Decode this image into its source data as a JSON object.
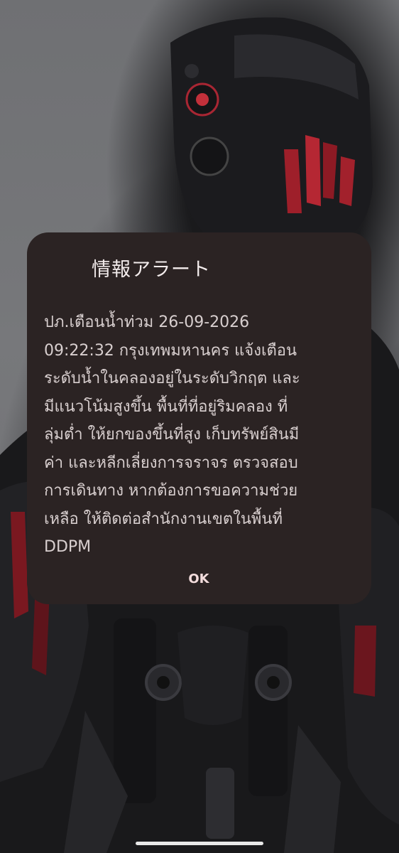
{
  "alert": {
    "title": "情報アラート",
    "message": "ปภ.เตือนน้ำท่วม  26-09-2026\n09:22:32 กรุงเทพมหานคร แจ้งเตือน\nระดับน้ำในคลองอยู่ในระดับวิกฤต และ\nมีแนวโน้มสูงขึ้น พื้นที่ที่อยู่ริมคลอง ที่\nลุ่มต่ำ ให้ยกของขึ้นที่สูง เก็บทรัพย์สินมี\nค่า และหลีกเลี่ยงการจราจร ตรวจสอบ\nการเดินทาง หากต้องการขอความช่วย\nเหลือ ให้ติดต่อสำนักงานเขตในพื้นที่\nDDPM",
    "ok_label": "OK"
  },
  "colors": {
    "dialog_background": "#2b2323",
    "title_text": "#f3ecec",
    "body_text": "#d8cfcf",
    "accent_red": "#c2303a"
  }
}
